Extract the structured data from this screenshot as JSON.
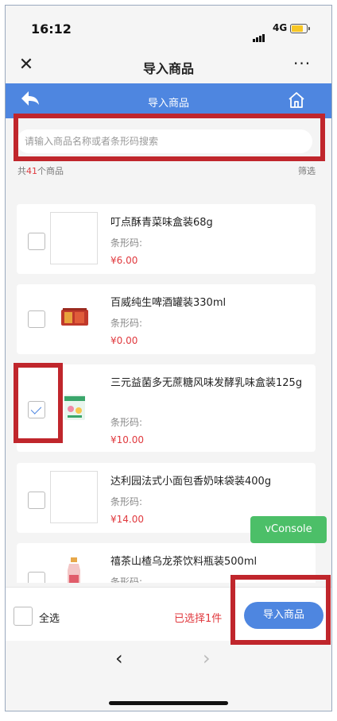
{
  "status_bar": {
    "time": "16:12",
    "network": "4G"
  },
  "title_bar": {
    "close_label": "✕",
    "title": "导入商品",
    "more_label": "···"
  },
  "blue_header": {
    "title": "导入商品"
  },
  "search": {
    "placeholder": "请输入商品名称或者条形码搜索"
  },
  "summary": {
    "prefix": "共",
    "count": "41",
    "suffix": "个商品",
    "filter_label": "筛选"
  },
  "products": [
    {
      "name": "叮点酥青菜味盒装68g",
      "barcode_label": "条形码:",
      "price": "¥6.00",
      "checked": false
    },
    {
      "name": "百威纯生啤酒罐装330ml",
      "barcode_label": "条形码:",
      "price": "¥0.00",
      "checked": false
    },
    {
      "name": "三元益菌多无蔗糖风味发酵乳味盒装125g",
      "barcode_label": "条形码:",
      "price": "¥10.00",
      "checked": true
    },
    {
      "name": "达利园法式小面包香奶味袋装400g",
      "barcode_label": "条形码:",
      "price": "¥14.00",
      "checked": false
    },
    {
      "name": "禧茶山楂乌龙茶饮料瓶装500ml",
      "barcode_label": "条形码:",
      "price": "",
      "checked": false
    }
  ],
  "footer": {
    "select_all_label": "全选",
    "selected_text": "已选择1件",
    "import_button": "导入商品"
  },
  "browser_nav": {
    "prev_label": "‹",
    "next_label": "›"
  },
  "vconsole_label": "vConsole",
  "colors": {
    "accent": "#4e86e0",
    "price": "#e0393e",
    "highlight": "#c0262c",
    "vconsole": "#4cbf68"
  }
}
